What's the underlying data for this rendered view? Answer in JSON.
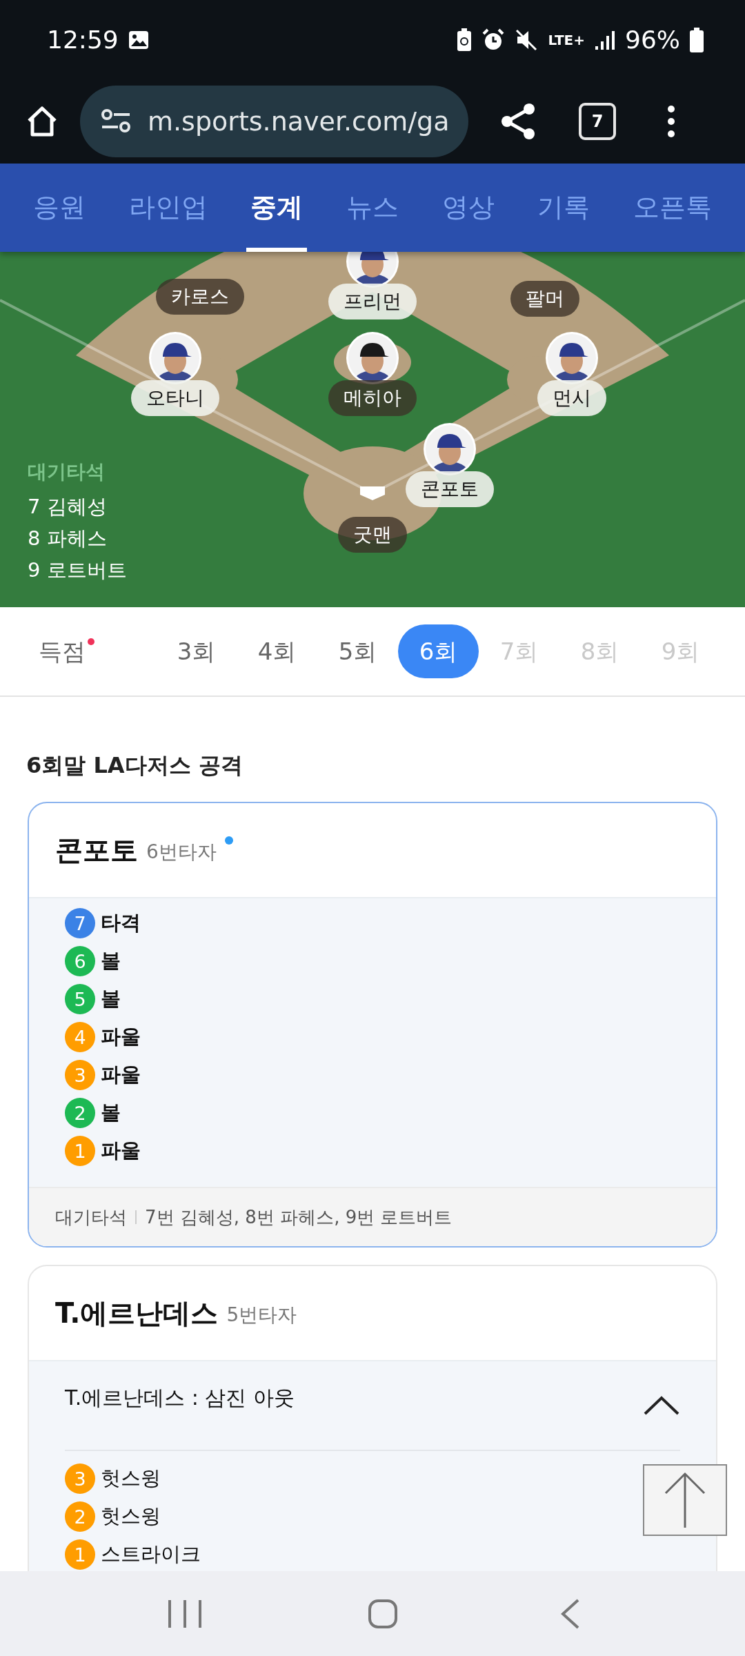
{
  "status_bar": {
    "time": "12:59",
    "network": "LTE+",
    "battery": "96%"
  },
  "browser": {
    "url": "m.sports.naver.com/ga",
    "tab_count": "7"
  },
  "nav_tabs": [
    {
      "label": "응원",
      "selected": false
    },
    {
      "label": "라인업",
      "selected": false
    },
    {
      "label": "중계",
      "selected": true
    },
    {
      "label": "뉴스",
      "selected": false
    },
    {
      "label": "영상",
      "selected": false
    },
    {
      "label": "기록",
      "selected": false
    },
    {
      "label": "오픈톡",
      "selected": false
    }
  ],
  "field": {
    "players": [
      {
        "name": "카로스",
        "kind": "fielder"
      },
      {
        "name": "프리먼",
        "kind": "runner"
      },
      {
        "name": "팔머",
        "kind": "fielder"
      },
      {
        "name": "오타니",
        "kind": "runner"
      },
      {
        "name": "메히아",
        "kind": "pitcher"
      },
      {
        "name": "먼시",
        "kind": "runner"
      },
      {
        "name": "콘포토",
        "kind": "runner"
      },
      {
        "name": "굿맨",
        "kind": "fielder"
      }
    ],
    "on_deck": {
      "title": "대기타석",
      "batters": [
        "7 김혜성",
        "8 파헤스",
        "9 로트버트"
      ]
    }
  },
  "innings": [
    {
      "label": "득점",
      "selected": false,
      "disabled": false,
      "new": true
    },
    {
      "label": "3회",
      "selected": false,
      "disabled": false,
      "new": false
    },
    {
      "label": "4회",
      "selected": false,
      "disabled": false,
      "new": false
    },
    {
      "label": "5회",
      "selected": false,
      "disabled": false,
      "new": false
    },
    {
      "label": "6회",
      "selected": true,
      "disabled": false,
      "new": false
    },
    {
      "label": "7회",
      "selected": false,
      "disabled": true,
      "new": false
    },
    {
      "label": "8회",
      "selected": false,
      "disabled": true,
      "new": false
    },
    {
      "label": "9회",
      "selected": false,
      "disabled": true,
      "new": false
    }
  ],
  "section_title": "6회말 LA다저스 공격",
  "at_bats": [
    {
      "batter": "콘포토",
      "order": "6번타자",
      "current": true,
      "pitches": [
        {
          "number": "7",
          "result": "타격",
          "color": "#3b82e6"
        },
        {
          "number": "6",
          "result": "볼",
          "color": "#1db954"
        },
        {
          "number": "5",
          "result": "볼",
          "color": "#1db954"
        },
        {
          "number": "4",
          "result": "파울",
          "color": "#ff9d00"
        },
        {
          "number": "3",
          "result": "파울",
          "color": "#ff9d00"
        },
        {
          "number": "2",
          "result": "볼",
          "color": "#1db954"
        },
        {
          "number": "1",
          "result": "파울",
          "color": "#ff9d00"
        }
      ],
      "on_deck_label": "대기타석",
      "on_deck": "7번 김혜성, 8번 파헤스, 9번 로트버트"
    },
    {
      "batter": "T.에르난데스",
      "order": "5번타자",
      "current": false,
      "result": "T.에르난데스 : 삼진 아웃",
      "expanded": true,
      "pitches": [
        {
          "number": "3",
          "result": "헛스윙",
          "color": "#ff9d00"
        },
        {
          "number": "2",
          "result": "헛스윙",
          "color": "#ff9d00"
        },
        {
          "number": "1",
          "result": "스트라이크",
          "color": "#ff9d00"
        }
      ]
    }
  ]
}
